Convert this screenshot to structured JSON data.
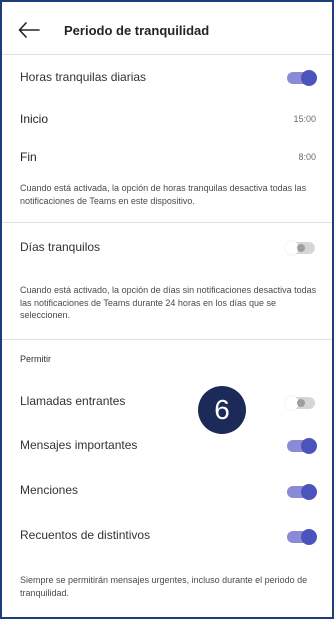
{
  "header": {
    "title": "Periodo de tranquilidad"
  },
  "daily_quiet_hours": {
    "label": "Horas tranquilas diarias",
    "enabled": true,
    "start_label": "Inicio",
    "start_value": "15:00",
    "end_label": "Fin",
    "end_value": "8:00",
    "description": "Cuando está activada, la opción de horas tranquilas desactiva todas las notificaciones de Teams en este dispositivo."
  },
  "quiet_days": {
    "label": "Días tranquilos",
    "enabled": false,
    "description": "Cuando está activado, la opción de días sin notificaciones desactiva todas las notificaciones de Teams durante 24 horas en los días que se seleccionen."
  },
  "allow": {
    "section_title": "Permitir",
    "items": [
      {
        "label": "Llamadas entrantes",
        "enabled": false
      },
      {
        "label": "Mensajes importantes",
        "enabled": true
      },
      {
        "label": "Menciones",
        "enabled": true
      },
      {
        "label": "Recuentos de distintivos",
        "enabled": true
      }
    ],
    "footer": "Siempre se permitirán mensajes urgentes, incluso durante el periodo de tranquilidad."
  },
  "step_badge": "6",
  "colors": {
    "toggle_on_track": "#8a8ad6",
    "toggle_on_knob": "#4b53bc",
    "toggle_off_track": "#d6d6d6",
    "badge": "#1b2a58",
    "frame_border": "#1f3d7a"
  }
}
